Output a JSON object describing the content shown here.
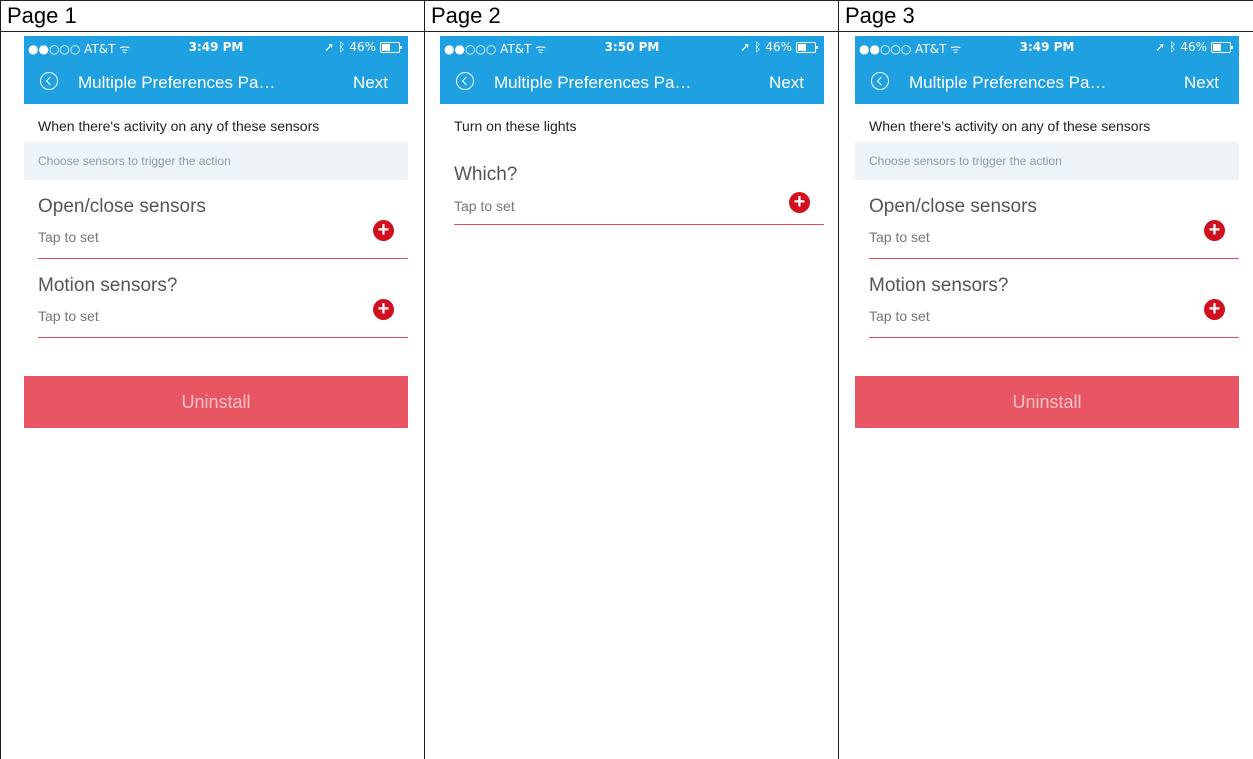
{
  "pages": [
    {
      "header": "Page 1",
      "status": {
        "carrier": "●●○○○ AT&T",
        "time": "3:49 PM",
        "battery": "46%"
      },
      "nav": {
        "title": "Multiple Preferences Pa…",
        "next": "Next"
      },
      "section_title": "When there's activity on any of these sensors",
      "hint": "Choose sensors to trigger the action",
      "prefs": [
        {
          "title": "Open/close sensors",
          "sub": "Tap to set"
        },
        {
          "title": "Motion sensors?",
          "sub": "Tap to set"
        }
      ],
      "uninstall": "Uninstall"
    },
    {
      "header": "Page 2",
      "status": {
        "carrier": "●●○○○ AT&T",
        "time": "3:50 PM",
        "battery": "46%"
      },
      "nav": {
        "title": "Multiple Preferences Pa…",
        "next": "Next"
      },
      "section_title": "Turn on these lights",
      "prefs": [
        {
          "title": "Which?",
          "sub": "Tap to set"
        }
      ]
    },
    {
      "header": "Page 3",
      "status": {
        "carrier": "●●○○○ AT&T",
        "time": "3:49 PM",
        "battery": "46%"
      },
      "nav": {
        "title": "Multiple Preferences Pa…",
        "next": "Next"
      },
      "section_title": "When there's activity on any of these sensors",
      "hint": "Choose sensors to trigger the action",
      "prefs": [
        {
          "title": "Open/close sensors",
          "sub": "Tap to set"
        },
        {
          "title": "Motion sensors?",
          "sub": "Tap to set"
        }
      ],
      "uninstall": "Uninstall"
    }
  ],
  "colors": {
    "topbar": "#1fa0e0",
    "accent": "#d0101f",
    "uninstall": "#e85563"
  },
  "icons": {
    "back": "back-circle-icon",
    "add": "plus-circle-icon",
    "location": "location-arrow-icon",
    "bluetooth": "bluetooth-icon",
    "wifi": "wifi-icon",
    "battery": "battery-icon"
  }
}
